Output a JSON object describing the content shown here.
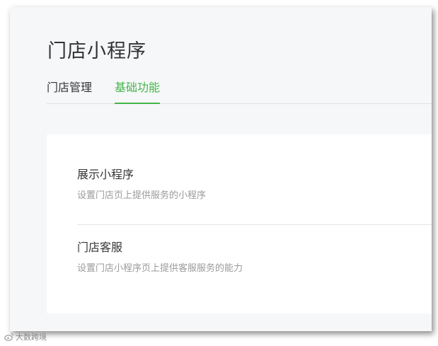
{
  "page": {
    "title": "门店小程序"
  },
  "tabs": [
    {
      "label": "门店管理",
      "active": false
    },
    {
      "label": "基础功能",
      "active": true
    }
  ],
  "settings": [
    {
      "title": "展示小程序",
      "description": "设置门店页上提供服务的小程序"
    },
    {
      "title": "门店客服",
      "description": "设置门店小程序页上提供客服服务的能力"
    }
  ],
  "watermark": {
    "icon": "weibo-icon",
    "text": "大数跨境"
  },
  "colors": {
    "accent": "#44b549",
    "background": "#f6f7f9",
    "card": "#ffffff",
    "title_text": "#333333",
    "description_text": "#9a9a9a"
  }
}
